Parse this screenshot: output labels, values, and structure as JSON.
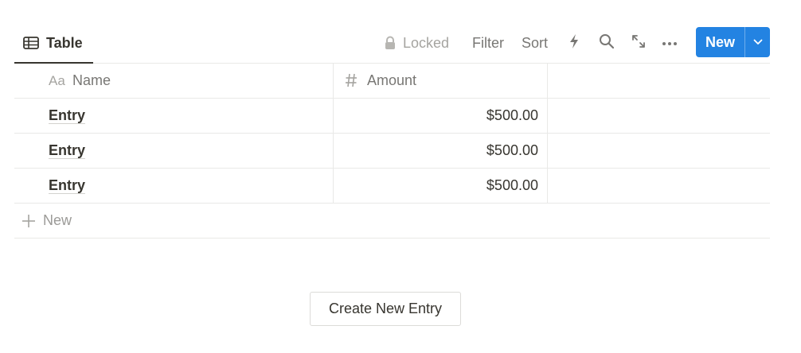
{
  "view": {
    "tab_label": "Table",
    "tab_icon": "table-icon"
  },
  "toolbar": {
    "locked_label": "Locked",
    "filter_label": "Filter",
    "sort_label": "Sort",
    "icons": [
      "lock-icon",
      "bolt-icon",
      "search-icon",
      "expand-icon",
      "more-icon",
      "chevron-down-icon"
    ],
    "new_label": "New",
    "accent_color": "#2383e2"
  },
  "table": {
    "columns": [
      {
        "icon_text": "Aa",
        "label": "Name"
      },
      {
        "icon": "number-icon",
        "label": "Amount"
      }
    ],
    "rows": [
      {
        "name": "Entry",
        "amount": "$500.00"
      },
      {
        "name": "Entry",
        "amount": "$500.00"
      },
      {
        "name": "Entry",
        "amount": "$500.00"
      }
    ],
    "new_row_label": "New"
  },
  "create_button_label": "Create New Entry"
}
